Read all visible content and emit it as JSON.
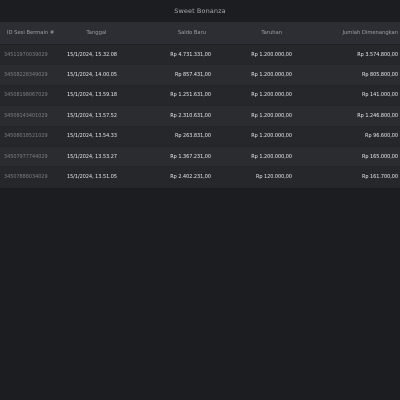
{
  "window": {
    "title": "Sweet Bonanza"
  },
  "table": {
    "columns": [
      "ID Sesi Bermain #",
      "Tanggal",
      "Saldo Baru",
      "Taruhan",
      "Jumlah Dimenangkan"
    ],
    "rows": [
      {
        "id": "34511970039029",
        "date": "15/1/2024, 15.32.08",
        "saldo": "Rp 4.731.331,00",
        "bet": "Rp 1.200.000,00",
        "win": "Rp 3.574.800,00"
      },
      {
        "id": "34508228349029",
        "date": "15/1/2024, 14.00.05",
        "saldo": "Rp 857.431,00",
        "bet": "Rp 1.200.000,00",
        "win": "Rp 805.800,00"
      },
      {
        "id": "34508198067029",
        "date": "15/1/2024, 13.59.18",
        "saldo": "Rp 1.251.631,00",
        "bet": "Rp 1.200.000,00",
        "win": "Rp 141.000,00"
      },
      {
        "id": "34508143401029",
        "date": "15/1/2024, 13.57.52",
        "saldo": "Rp 2.310.631,00",
        "bet": "Rp 1.200.000,00",
        "win": "Rp 1.246.800,00"
      },
      {
        "id": "34508018521029",
        "date": "15/1/2024, 13.54.33",
        "saldo": "Rp 263.831,00",
        "bet": "Rp 1.200.000,00",
        "win": "Rp 96.600,00"
      },
      {
        "id": "34507977744029",
        "date": "15/1/2024, 13.53.27",
        "saldo": "Rp 1.367.231,00",
        "bet": "Rp 1.200.000,00",
        "win": "Rp 165.000,00"
      },
      {
        "id": "34507888034029",
        "date": "15/1/2024, 13.51.05",
        "saldo": "Rp 2.402.231,00",
        "bet": "Rp 120.000,00",
        "win": "Rp 161.700,00"
      }
    ]
  },
  "colors": {
    "background": "#1c1d21",
    "table_background": "#25272b",
    "header_background": "#2c2e33",
    "text": "#e8e9ea",
    "muted_text": "#7c7f84"
  }
}
